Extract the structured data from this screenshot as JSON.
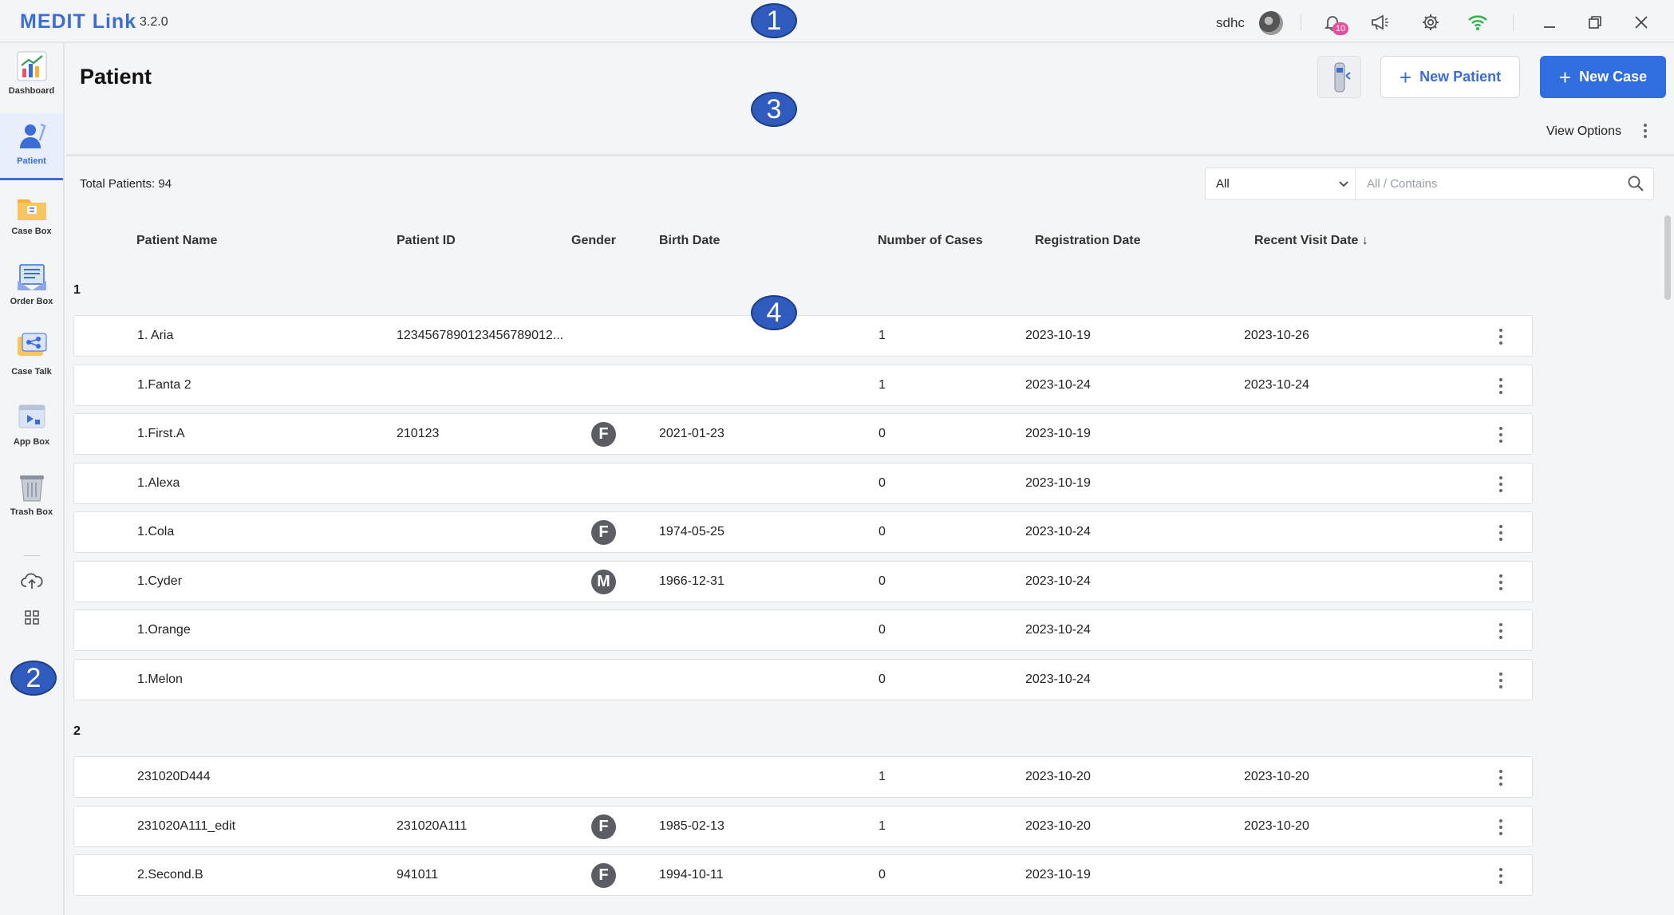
{
  "app": {
    "brand": "MEDIT Link",
    "version": "3.2.0",
    "username": "sdhc",
    "notification_count": "10"
  },
  "sidebar": {
    "items": [
      {
        "label": "Dashboard",
        "icon": "dashboard-icon"
      },
      {
        "label": "Patient",
        "icon": "patient-icon",
        "active": true
      },
      {
        "label": "Case Box",
        "icon": "case-box-icon"
      },
      {
        "label": "Order Box",
        "icon": "order-box-icon"
      },
      {
        "label": "Case Talk",
        "icon": "case-talk-icon"
      },
      {
        "label": "App Box",
        "icon": "app-box-icon"
      },
      {
        "label": "Trash Box",
        "icon": "trash-box-icon"
      }
    ]
  },
  "header": {
    "title": "Patient",
    "new_patient_label": "New Patient",
    "new_case_label": "New Case",
    "view_options_label": "View Options"
  },
  "list": {
    "total_label": "Total Patients: 94",
    "filter_value": "All",
    "search_placeholder": "All / Contains",
    "columns": {
      "name": "Patient Name",
      "id": "Patient ID",
      "gender": "Gender",
      "birth": "Birth Date",
      "cases": "Number of Cases",
      "registration": "Registration Date",
      "recent": "Recent Visit Date"
    },
    "groups": [
      {
        "label": "1",
        "rows": [
          {
            "name": "1. Aria",
            "id": "123456789012345678901​2...",
            "gender": "",
            "birth": "",
            "cases": "1",
            "registration": "2023-10-19",
            "recent": "2023-10-26"
          },
          {
            "name": "1.Fanta 2",
            "id": "",
            "gender": "",
            "birth": "",
            "cases": "1",
            "registration": "2023-10-24",
            "recent": "2023-10-24"
          },
          {
            "name": "1.First.A",
            "id": "210123",
            "gender": "F",
            "birth": "2021-01-23",
            "cases": "0",
            "registration": "2023-10-19",
            "recent": ""
          },
          {
            "name": "1.Alexa",
            "id": "",
            "gender": "",
            "birth": "",
            "cases": "0",
            "registration": "2023-10-19",
            "recent": ""
          },
          {
            "name": "1.Cola",
            "id": "",
            "gender": "F",
            "birth": "1974-05-25",
            "cases": "0",
            "registration": "2023-10-24",
            "recent": ""
          },
          {
            "name": "1.Cyder",
            "id": "",
            "gender": "M",
            "birth": "1966-12-31",
            "cases": "0",
            "registration": "2023-10-24",
            "recent": ""
          },
          {
            "name": "1.Orange",
            "id": "",
            "gender": "",
            "birth": "",
            "cases": "0",
            "registration": "2023-10-24",
            "recent": ""
          },
          {
            "name": "1.Melon",
            "id": "",
            "gender": "",
            "birth": "",
            "cases": "0",
            "registration": "2023-10-24",
            "recent": ""
          }
        ]
      },
      {
        "label": "2",
        "rows": [
          {
            "name": "231020D444",
            "id": "",
            "gender": "",
            "birth": "",
            "cases": "1",
            "registration": "2023-10-20",
            "recent": "2023-10-20"
          },
          {
            "name": "231020A111_edit",
            "id": "231020A111",
            "gender": "F",
            "birth": "1985-02-13",
            "cases": "1",
            "registration": "2023-10-20",
            "recent": "2023-10-20"
          },
          {
            "name": "2.Second.B",
            "id": "941011",
            "gender": "F",
            "birth": "1994-10-11",
            "cases": "0",
            "registration": "2023-10-19",
            "recent": ""
          }
        ]
      }
    ]
  },
  "annotations": [
    "1",
    "2",
    "3",
    "4"
  ],
  "colors": {
    "accent": "#2f6de1",
    "brand": "#3b6cd8",
    "badge": "#e84f9b",
    "marker": "#2f5bbf"
  }
}
